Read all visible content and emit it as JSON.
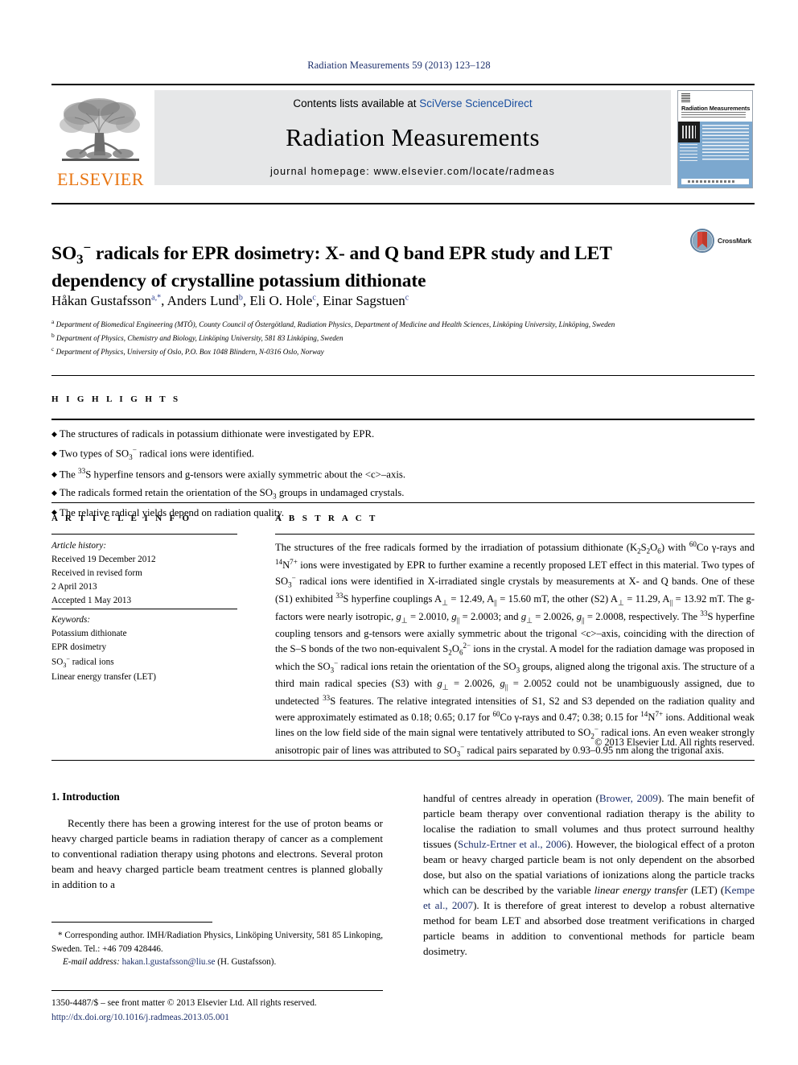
{
  "running_head": "Radiation Measurements 59 (2013) 123–128",
  "masthead": {
    "publisher_name": "ELSEVIER",
    "contents_prefix": "Contents lists available at ",
    "contents_link": "SciVerse ScienceDirect",
    "journal_title": "Radiation Measurements",
    "homepage": "journal homepage: www.elsevier.com/locate/radmeas",
    "cover_title": "Radiation Measurements"
  },
  "crossmark": {
    "label": "CrossMark"
  },
  "article": {
    "title_line1": "SO3⁻ radicals for EPR dosimetry: X- and Q band EPR study and LET",
    "title_line2": "dependency of crystalline potassium dithionate",
    "authors": "Håkan Gustafsson a,*, Anders Lund b, Eli O. Hole c, Einar Sagstuen c",
    "affiliations": [
      "a Department of Biomedical Engineering (MTÖ), County Council of Östergötland, Radiation Physics, Department of Medicine and Health Sciences, Linköping University, Linköping, Sweden",
      "b Department of Physics, Chemistry and Biology, Linköping University, 581 83 Linköping, Sweden",
      "c Department of Physics, University of Oslo, P.O. Box 1048 Blindern, N-0316 Oslo, Norway"
    ]
  },
  "highlights": {
    "heading": "H I G H L I G H T S",
    "items": [
      "The structures of radicals in potassium dithionate were investigated by EPR.",
      "Two types of SO3⁻ radical ions were identified.",
      "The 33S hyperfine tensors and g-tensors were axially symmetric about the <c>-axis.",
      "The radicals formed retain the orientation of the SO3 groups in undamaged crystals.",
      "The relative radical yields depend on radiation quality."
    ]
  },
  "article_info": {
    "heading": "A R T I C L E   I N F O",
    "history_label": "Article history:",
    "history": [
      "Received 19 December 2012",
      "Received in revised form",
      "2 April 2013",
      "Accepted 1 May 2013"
    ],
    "keywords_label": "Keywords:",
    "keywords": [
      "Potassium dithionate",
      "EPR dosimetry",
      " radical ions",
      "Linear energy transfer (LET)"
    ]
  },
  "abstract": {
    "heading": "A B S T R A C T",
    "text": "The structures of the free radicals formed by the irradiation of potassium dithionate (K2S2O6) with 60Co γ-rays and 14N7+ ions were investigated by EPR to further examine a recently proposed LET effect in this material. Two types of SO3⁻ radical ions were identified in X-irradiated single crystals by measurements at X- and Q bands. One of these (S1) exhibited 33S hyperfine couplings A⊥ = 12.49, A∥ = 15.60 mT, the other (S2) A⊥ = 11.29, A∥ = 13.92 mT. The g-factors were nearly isotropic, g⊥ = 2.0010, g∥ = 2.0003; and g⊥ = 2.0026, g∥ = 2.0008, respectively. The 33S hyperfine coupling tensors and g-tensors were axially symmetric about the trigonal <c>-axis, coinciding with the direction of the S–S bonds of the two non-equivalent S2O6 2− ions in the crystal. A model for the radiation damage was proposed in which the SO3⁻ radical ions retain the orientation of the SO3 groups, aligned along the trigonal axis. The structure of a third main radical species (S3) with g⊥ = 2.0026, g∥ = 2.0052 could not be unambiguously assigned, due to undetected 33S features. The relative integrated intensities of S1, S2 and S3 depended on the radiation quality and were approximately estimated as 0.18; 0.65; 0.17 for 60Co γ-rays and 0.47; 0.38; 0.15 for 14N7+ ions. Additional weak lines on the low field side of the main signal were tentatively attributed to SO2⁻ radical ions. An even weaker strongly anisotropic pair of lines was attributed to SO3⁻ radical pairs separated by 0.93–0.95 nm along the trigonal axis.",
    "copyright": "© 2013 Elsevier Ltd. All rights reserved."
  },
  "body": {
    "section_number": "1.",
    "section_title": "Introduction",
    "left_paragraph": "Recently there has been a growing interest for the use of proton beams or heavy charged particle beams in radiation therapy of cancer as a complement to conventional radiation therapy using photons and electrons. Several proton beam and heavy charged particle beam treatment centres is planned globally in addition to a",
    "right_paragraph": "handful of centres already in operation (Brower, 2009). The main benefit of particle beam therapy over conventional radiation therapy is the ability to localise the radiation to small volumes and thus protect surround healthy tissues (Schulz-Ertner et al., 2006). However, the biological effect of a proton beam or heavy charged particle beam is not only dependent on the absorbed dose, but also on the spatial variations of ionizations along the particle tracks which can be described by the variable linear energy transfer (LET) (Kempe et al., 2007). It is therefore of great interest to develop a robust alternative method for beam LET and absorbed dose treatment verifications in charged particle beams in addition to conventional methods for particle beam dosimetry.",
    "references": [
      "Brower, 2009",
      "Schulz-Ertner et al., 2006",
      "Kempe et al., 2007"
    ],
    "italic_phrase": "linear energy transfer"
  },
  "footnote": {
    "corresponding": "* Corresponding author. IMH/Radiation Physics, Linköping University, 581 85 Linkoping, Sweden. Tel.: +46 709 428446.",
    "email_label": "E-mail address:",
    "email": "hakan.l.gustafsson@liu.se",
    "email_owner": "(H. Gustafsson)."
  },
  "imprint": {
    "issn_line": "1350-4487/$ – see front matter © 2013 Elsevier Ltd. All rights reserved.",
    "doi": "http://dx.doi.org/10.1016/j.radmeas.2013.05.001"
  },
  "colors": {
    "link_blue": "#1c2f6b",
    "sciencedirect_blue": "#1a4fa0",
    "elsevier_orange": "#e87511",
    "cover_blue": "#7ca8cf"
  }
}
